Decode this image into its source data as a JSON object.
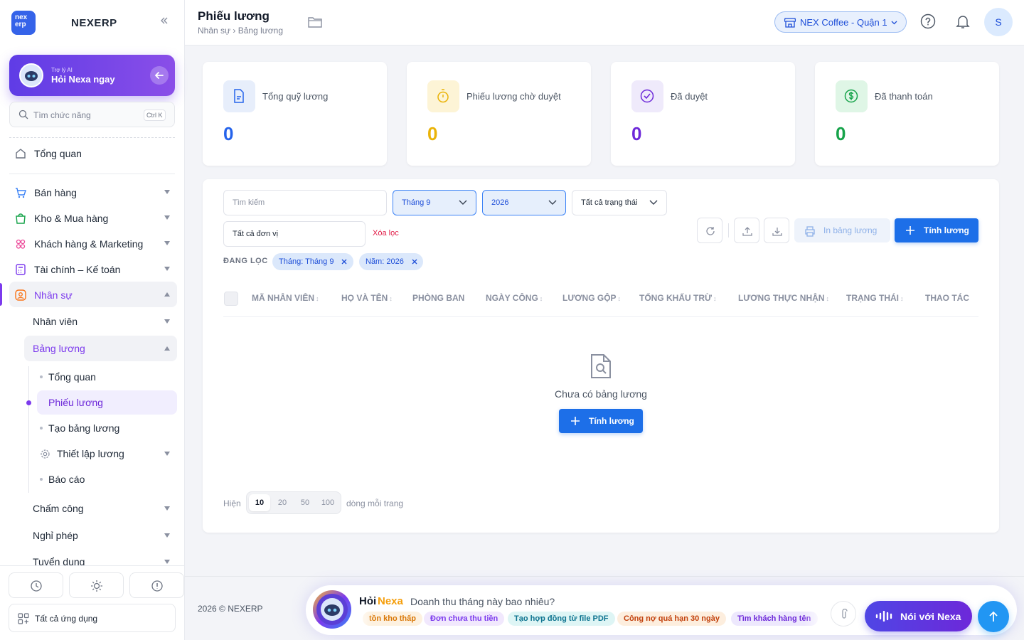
{
  "sidebar": {
    "logo": "nex erp",
    "brand": "NEXERP",
    "ai": {
      "sub": "Trợ lý AI",
      "title": "Hỏi Nexa ngay"
    },
    "search_placeholder": "Tìm chức năng",
    "shortcut": "Ctrl K",
    "overview": "Tổng quan",
    "groups": [
      {
        "label": "Bán hàng",
        "icon": "cart-icon"
      },
      {
        "label": "Kho & Mua hàng",
        "icon": "bag-icon"
      },
      {
        "label": "Khách hàng & Marketing",
        "icon": "people-icon"
      },
      {
        "label": "Tài chính – Kế toán",
        "icon": "calculator-icon"
      },
      {
        "label": "Nhân sự",
        "icon": "user-icon"
      }
    ],
    "hr_children": [
      {
        "label": "Nhân viên"
      },
      {
        "label": "Bảng lương"
      }
    ],
    "payroll_children": [
      {
        "label": "Tổng quan"
      },
      {
        "label": "Phiếu lương"
      },
      {
        "label": "Tạo bảng lương"
      },
      {
        "label": "Thiết lập lương"
      },
      {
        "label": "Báo cáo"
      }
    ],
    "hr_more": [
      {
        "label": "Chấm công"
      },
      {
        "label": "Nghỉ phép"
      },
      {
        "label": "Tuyển dụng"
      }
    ],
    "bottom_icons": [
      "clock-icon",
      "sun-icon",
      "alert-icon"
    ],
    "all_apps": "Tất cả ứng dụng"
  },
  "header": {
    "title": "Phiếu lương",
    "breadcrumb": "Nhân sự › Bảng lương",
    "branch": "NEX Coffee - Quận 1",
    "avatar": "S"
  },
  "stats": [
    {
      "label": "Tổng quỹ lương",
      "value": "0",
      "color": "#2563eb",
      "bg": "#e7eefb",
      "icon": "document-icon"
    },
    {
      "label": "Phiếu lương chờ duyệt",
      "value": "0",
      "color": "#eab308",
      "bg": "#fdf4d6",
      "icon": "timer-icon"
    },
    {
      "label": "Đã duyệt",
      "value": "0",
      "color": "#6d28d9",
      "bg": "#efeafb",
      "icon": "check-circle-icon"
    },
    {
      "label": "Đã thanh toán",
      "value": "0",
      "color": "#16a34a",
      "bg": "#dff6e6",
      "icon": "dollar-icon"
    }
  ],
  "filters": {
    "search_placeholder": "Tìm kiếm",
    "month": "Tháng 9",
    "year": "2026",
    "status": "Tất cả trạng thái",
    "unit": "Tất cả đơn vị",
    "clear": "Xóa lọc",
    "active_label": "ĐANG LỌC",
    "chips": [
      "Tháng: Tháng 9",
      "Năm: 2026"
    ]
  },
  "actions": {
    "print": "In bảng lương",
    "calculate": "Tính lương"
  },
  "table": {
    "columns": [
      "MÃ NHÂN VIÊN",
      "HỌ VÀ TÊN",
      "PHÒNG BAN",
      "NGÀY CÔNG",
      "LƯƠNG GỘP",
      "TỔNG KHẤU TRỪ",
      "LƯƠNG THỰC NHẬN",
      "TRẠNG THÁI",
      "THAO TÁC"
    ],
    "empty": "Chưa có bảng lương",
    "empty_button": "Tính lương"
  },
  "pagination": {
    "show": "Hiện",
    "sizes": [
      "10",
      "20",
      "50",
      "100"
    ],
    "selected": "10",
    "suffix": "dòng mỗi trang"
  },
  "footer": {
    "copyright": "2026 © NEXERP",
    "ask": "Hỏi",
    "nexa": "Nexa",
    "question": "Doanh thu tháng này bao nhiêu?",
    "suggestions": [
      {
        "text": "tồn kho thấp",
        "bg": "#fdf1e0",
        "color": "#d97706"
      },
      {
        "text": "Đơn chưa thu tiền",
        "bg": "#f1e8fd",
        "color": "#7c3aed"
      },
      {
        "text": "Tạo hợp đồng từ file PDF",
        "bg": "#def5f5",
        "color": "#0e7490"
      },
      {
        "text": "Công nợ quá hạn 30 ngày",
        "bg": "#fdeede",
        "color": "#c2410c"
      },
      {
        "text": "Tìm khách hàng tên",
        "bg": "#ede8fd",
        "color": "#6d28d9"
      }
    ],
    "talk": "Nói với Nexa"
  }
}
